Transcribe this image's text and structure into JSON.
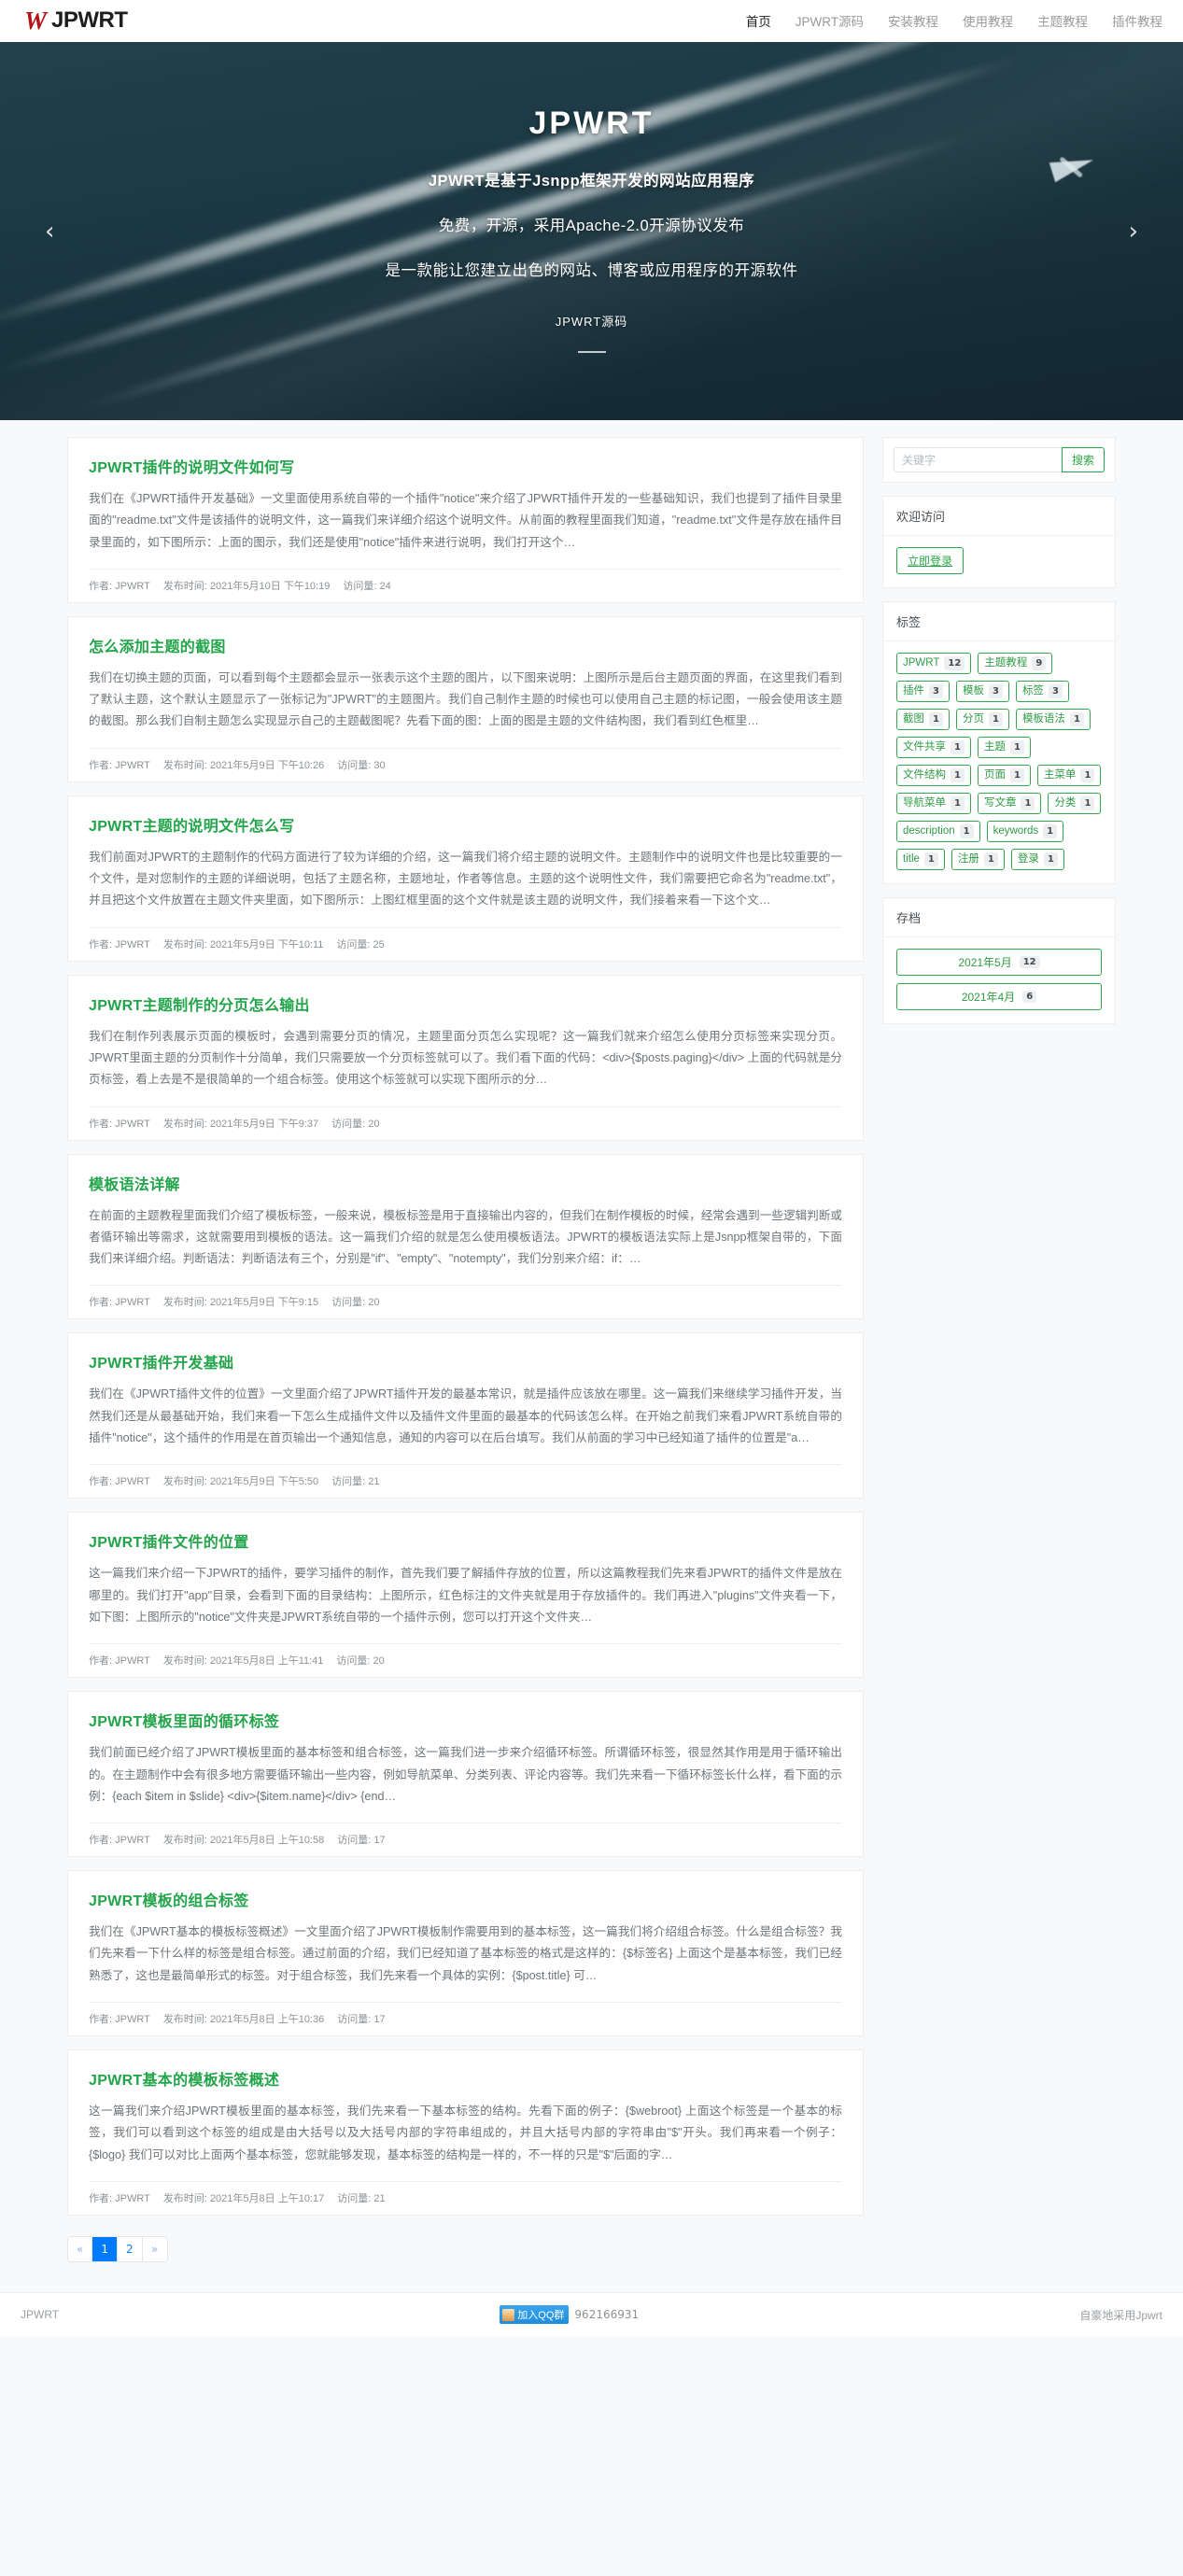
{
  "header": {
    "brand_mark": "W",
    "brand_text": "JPWRT",
    "nav": [
      {
        "label": "首页",
        "active": true
      },
      {
        "label": "JPWRT源码",
        "active": false
      },
      {
        "label": "安装教程",
        "active": false
      },
      {
        "label": "使用教程",
        "active": false
      },
      {
        "label": "主题教程",
        "active": false
      },
      {
        "label": "插件教程",
        "active": false
      }
    ]
  },
  "hero": {
    "title": "JPWRT",
    "line1": "JPWRT是基于Jsnpp框架开发的网站应用程序",
    "line2": "免费，开源，采用Apache-2.0开源协议发布",
    "line3": "是一款能让您建立出色的网站、博客或应用程序的开源软件",
    "caption": "JPWRT源码",
    "prev_arrow": "‹",
    "next_arrow": "›"
  },
  "meta_labels": {
    "author": "作者:",
    "published": "发布时间:",
    "views": "访问量:"
  },
  "posts": [
    {
      "title": "JPWRT插件的说明文件如何写",
      "excerpt": "我们在《JPWRT插件开发基础》一文里面使用系统自带的一个插件\"notice\"来介绍了JPWRT插件开发的一些基础知识，我们也提到了插件目录里面的\"readme.txt\"文件是该插件的说明文件，这一篇我们来详细介绍这个说明文件。从前面的教程里面我们知道，\"readme.txt\"文件是存放在插件目录里面的，如下图所示：上面的图示，我们还是使用\"notice\"插件来进行说明，我们打开这个…",
      "author": "JPWRT",
      "date": "2021年5月10日 下午10:19",
      "views": "24"
    },
    {
      "title": "怎么添加主题的截图",
      "excerpt": "我们在切换主题的页面，可以看到每个主题都会显示一张表示这个主题的图片，以下图来说明：上图所示是后台主题页面的界面，在这里我们看到了默认主题，这个默认主题显示了一张标记为\"JPWRT\"的主题图片。我们自己制作主题的时候也可以使用自己主题的标记图，一般会使用该主题的截图。那么我们自制主题怎么实现显示自己的主题截图呢？先看下面的图：上面的图是主题的文件结构图，我们看到红色框里…",
      "author": "JPWRT",
      "date": "2021年5月9日 下午10:26",
      "views": "30"
    },
    {
      "title": "JPWRT主题的说明文件怎么写",
      "excerpt": "我们前面对JPWRT的主题制作的代码方面进行了较为详细的介绍，这一篇我们将介绍主题的说明文件。主题制作中的说明文件也是比较重要的一个文件，是对您制作的主题的详细说明，包括了主题名称，主题地址，作者等信息。主题的这个说明性文件，我们需要把它命名为\"readme.txt\"，并且把这个文件放置在主题文件夹里面，如下图所示：上图红框里面的这个文件就是该主题的说明文件，我们接着来看一下这个文…",
      "author": "JPWRT",
      "date": "2021年5月9日 下午10:11",
      "views": "25"
    },
    {
      "title": "JPWRT主题制作的分页怎么输出",
      "excerpt": "我们在制作列表展示页面的模板时，会遇到需要分页的情况，主题里面分页怎么实现呢？这一篇我们就来介绍怎么使用分页标签来实现分页。JPWRT里面主题的分页制作十分简单，我们只需要放一个分页标签就可以了。我们看下面的代码：<div>{$posts.paging}</div> 上面的代码就是分页标签，看上去是不是很简单的一个组合标签。使用这个标签就可以实现下图所示的分…",
      "author": "JPWRT",
      "date": "2021年5月9日 下午9:37",
      "views": "20"
    },
    {
      "title": "模板语法详解",
      "excerpt": "在前面的主题教程里面我们介绍了模板标签，一般来说，模板标签是用于直接输出内容的，但我们在制作模板的时候，经常会遇到一些逻辑判断或者循环输出等需求，这就需要用到模板的语法。这一篇我们介绍的就是怎么使用模板语法。JPWRT的模板语法实际上是Jsnpp框架自带的，下面我们来详细介绍。判断语法：判断语法有三个，分别是\"if\"、\"empty\"、\"notempty\"，我们分别来介绍：if：…",
      "author": "JPWRT",
      "date": "2021年5月9日 下午9:15",
      "views": "20"
    },
    {
      "title": "JPWRT插件开发基础",
      "excerpt": "我们在《JPWRT插件文件的位置》一文里面介绍了JPWRT插件开发的最基本常识，就是插件应该放在哪里。这一篇我们来继续学习插件开发，当然我们还是从最基础开始，我们来看一下怎么生成插件文件以及插件文件里面的最基本的代码该怎么样。在开始之前我们来看JPWRT系统自带的插件\"notice\"，这个插件的作用是在首页输出一个通知信息，通知的内容可以在后台填写。我们从前面的学习中已经知道了插件的位置是\"a…",
      "author": "JPWRT",
      "date": "2021年5月9日 下午5:50",
      "views": "21"
    },
    {
      "title": "JPWRT插件文件的位置",
      "excerpt": "这一篇我们来介绍一下JPWRT的插件，要学习插件的制作，首先我们要了解插件存放的位置，所以这篇教程我们先来看JPWRT的插件文件是放在哪里的。我们打开\"app\"目录，会看到下面的目录结构：上图所示，红色标注的文件夹就是用于存放插件的。我们再进入\"plugins\"文件夹看一下，如下图：上图所示的\"notice\"文件夹是JPWRT系统自带的一个插件示例，您可以打开这个文件夹…",
      "author": "JPWRT",
      "date": "2021年5月8日 上午11:41",
      "views": "20"
    },
    {
      "title": "JPWRT模板里面的循环标签",
      "excerpt": "我们前面已经介绍了JPWRT模板里面的基本标签和组合标签，这一篇我们进一步来介绍循环标签。所谓循环标签，很显然其作用是用于循环输出的。在主题制作中会有很多地方需要循环输出一些内容，例如导航菜单、分类列表、评论内容等。我们先来看一下循环标签长什么样，看下面的示例：{each $item in $slide} <div>{$item.name}</div> {end…",
      "author": "JPWRT",
      "date": "2021年5月8日 上午10:58",
      "views": "17"
    },
    {
      "title": "JPWRT模板的组合标签",
      "excerpt": "我们在《JPWRT基本的模板标签概述》一文里面介绍了JPWRT模板制作需要用到的基本标签，这一篇我们将介绍组合标签。什么是组合标签？我们先来看一下什么样的标签是组合标签。通过前面的介绍，我们已经知道了基本标签的格式是这样的：{$标签名} 上面这个是基本标签，我们已经熟悉了，这也是最简单形式的标签。对于组合标签，我们先来看一个具体的实例：{$post.title} 可…",
      "author": "JPWRT",
      "date": "2021年5月8日 上午10:36",
      "views": "17"
    },
    {
      "title": "JPWRT基本的模板标签概述",
      "excerpt": "这一篇我们来介绍JPWRT模板里面的基本标签，我们先来看一下基本标签的结构。先看下面的例子：{$webroot} 上面这个标签是一个基本的标签，我们可以看到这个标签的组成是由大括号以及大括号内部的字符串组成的，并且大括号内部的字符串由\"$\"开头。我们再来看一个例子：{$logo} 我们可以对比上面两个基本标签，您就能够发现，基本标签的结构是一样的，不一样的只是\"$\"后面的字…",
      "author": "JPWRT",
      "date": "2021年5月8日 上午10:17",
      "views": "21"
    }
  ],
  "pagination": {
    "prev": "«",
    "next": "»",
    "pages": [
      {
        "label": "1",
        "active": true
      },
      {
        "label": "2",
        "active": false
      }
    ]
  },
  "sidebar": {
    "search": {
      "placeholder": "关键字",
      "value": "",
      "button": "搜索"
    },
    "welcome": {
      "title": "欢迎访问",
      "login_button": "立即登录"
    },
    "tags": {
      "title": "标签",
      "items": [
        {
          "label": "JPWRT",
          "count": "12"
        },
        {
          "label": "主题教程",
          "count": "9"
        },
        {
          "label": "插件",
          "count": "3"
        },
        {
          "label": "模板",
          "count": "3"
        },
        {
          "label": "标签",
          "count": "3"
        },
        {
          "label": "截图",
          "count": "1"
        },
        {
          "label": "分页",
          "count": "1"
        },
        {
          "label": "模板语法",
          "count": "1"
        },
        {
          "label": "文件共享",
          "count": "1"
        },
        {
          "label": "主题",
          "count": "1"
        },
        {
          "label": "文件结构",
          "count": "1"
        },
        {
          "label": "页面",
          "count": "1"
        },
        {
          "label": "主菜单",
          "count": "1"
        },
        {
          "label": "导航菜单",
          "count": "1"
        },
        {
          "label": "写文章",
          "count": "1"
        },
        {
          "label": "分类",
          "count": "1"
        },
        {
          "label": "description",
          "count": "1"
        },
        {
          "label": "keywords",
          "count": "1"
        },
        {
          "label": "title",
          "count": "1"
        },
        {
          "label": "注册",
          "count": "1"
        },
        {
          "label": "登录",
          "count": "1"
        }
      ]
    },
    "archive": {
      "title": "存档",
      "items": [
        {
          "label": "2021年5月",
          "count": "12"
        },
        {
          "label": "2021年4月",
          "count": "6"
        }
      ]
    }
  },
  "footer": {
    "left": "JPWRT",
    "qq_label": "加入QQ群",
    "qq_number": "962166931",
    "right": "自豪地采用Jpwrt"
  }
}
